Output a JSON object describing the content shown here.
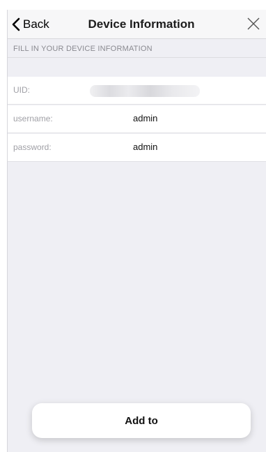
{
  "navbar": {
    "back_label": "Back",
    "title": "Device Information",
    "back_icon": "chevron-left-icon",
    "close_icon": "close-icon"
  },
  "section": {
    "header": "FILL IN YOUR DEVICE INFORMATION"
  },
  "form": {
    "uid": {
      "label": "UID:",
      "value": ""
    },
    "username": {
      "label": "username:",
      "value": "admin"
    },
    "password": {
      "label": "password:",
      "value": "admin"
    }
  },
  "actions": {
    "add_label": "Add to"
  },
  "colors": {
    "background": "#efeff4",
    "navbar": "#f7f7f8",
    "label": "#a0a0a6"
  }
}
